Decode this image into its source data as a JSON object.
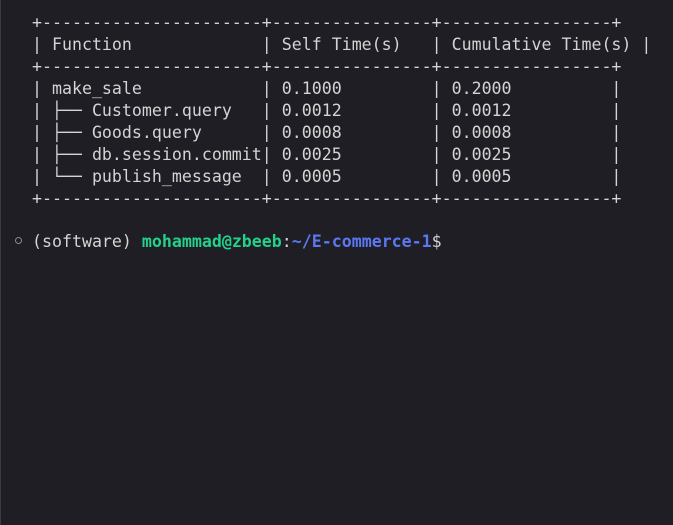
{
  "terminal": {
    "output_lines": [
      "+----------------------+----------------+-----------------+",
      "| Function             | Self Time(s)   | Cumulative Time(s) |",
      "+----------------------+----------------+-----------------+",
      "| make_sale            | 0.1000         | 0.2000          |",
      "| ├── Customer.query   | 0.0012         | 0.0012          |",
      "| ├── Goods.query      | 0.0008         | 0.0008          |",
      "| ├── db.session.commit| 0.0025         | 0.0025          |",
      "| └── publish_message  | 0.0005         | 0.0005          |",
      "+----------------------+----------------+-----------------+"
    ],
    "prompt": {
      "env": "(software) ",
      "user_host": "mohammad@zbeeb",
      "colon": ":",
      "cwd": "~/E-commerce-1",
      "symbol": "$"
    },
    "colors": {
      "background": "#1e1e24",
      "text": "#d4d4d4",
      "user_host": "#23d18b",
      "cwd": "#5c78f0"
    }
  }
}
